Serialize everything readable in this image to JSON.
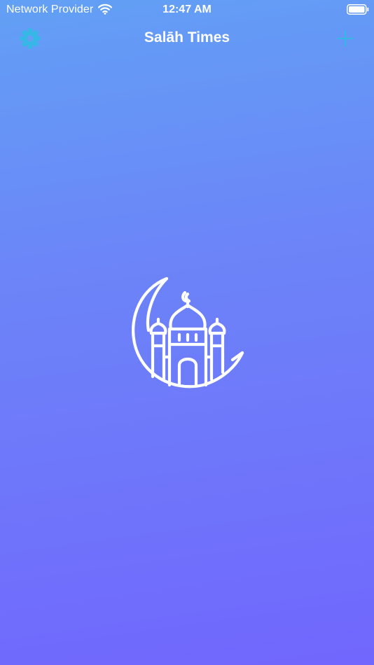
{
  "status_bar": {
    "carrier": "Network Provider",
    "time": "12:47 AM",
    "wifi_icon": "wifi-icon",
    "battery_icon": "battery-icon"
  },
  "nav_bar": {
    "title": "Salāh Times",
    "left_icon": "gear-icon",
    "right_icon": "plus-icon"
  },
  "main": {
    "logo_icon": "mosque-crescent-icon"
  },
  "colors": {
    "gradient_top": "#62A0F5",
    "gradient_bottom": "#7166FD",
    "accent": "#35B8E6",
    "text": "#FFFFFF"
  }
}
